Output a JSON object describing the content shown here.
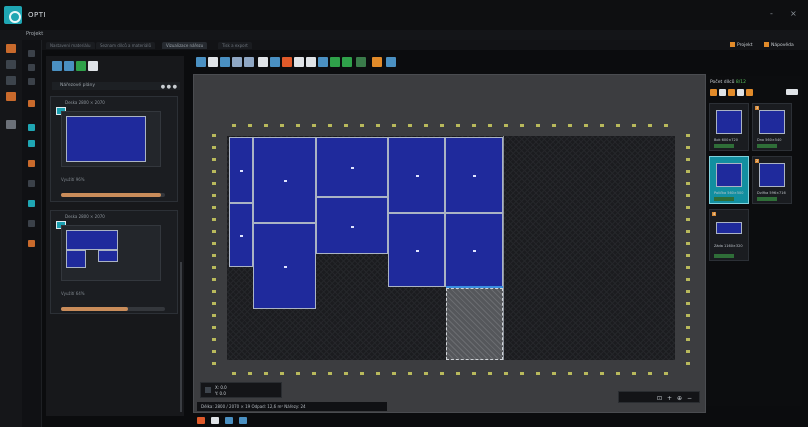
{
  "app": {
    "name": "OPTI",
    "menu": "Projekt",
    "window_controls": [
      "-",
      "×"
    ]
  },
  "top_tabs": [
    {
      "label": "Nastavení materiálu",
      "active": false
    },
    {
      "label": "Seznam dílců a materiálů",
      "active": false
    },
    {
      "label": "Vizualizace nářezu",
      "active": true
    },
    {
      "label": "Tisk a export",
      "active": false
    }
  ],
  "top_right": {
    "btn1": "Projekt",
    "btn2": "Nápověda"
  },
  "left_panel": {
    "header": "Nářezové plány",
    "dots": "● ● ●",
    "cards": [
      {
        "title": "Deska 2800 × 2070",
        "info": "Využití 96%",
        "progress": 0.96
      },
      {
        "title": "Deska 2800 × 2070",
        "info": "Využití 64%",
        "progress": 0.64
      }
    ]
  },
  "canvas": {
    "coord_label_1": "X: 0.0",
    "coord_label_2": "Y: 0.0"
  },
  "status": {
    "text": "Délka: 2800 / 2070 × 19   Odpad: 12,6 m²   Nářezy: 24"
  },
  "right_panel": {
    "title_prefix": "Počet dílců",
    "title_count": "8/12",
    "tiles": [
      {
        "label": "Bok 600×720",
        "num": "2"
      },
      {
        "label": "Dno 560×540",
        "num": "3"
      },
      {
        "label": "Polička 560×500",
        "num": "1"
      },
      {
        "label": "Dvířka 596×716",
        "num": "2"
      },
      {
        "label": "Záda 1160×320",
        "num": "4"
      }
    ]
  },
  "colors": {
    "accent": "#1fa6b3",
    "part_fill": "#1f2a9c",
    "orange": "#e28b2a",
    "green": "#5ac15d"
  }
}
